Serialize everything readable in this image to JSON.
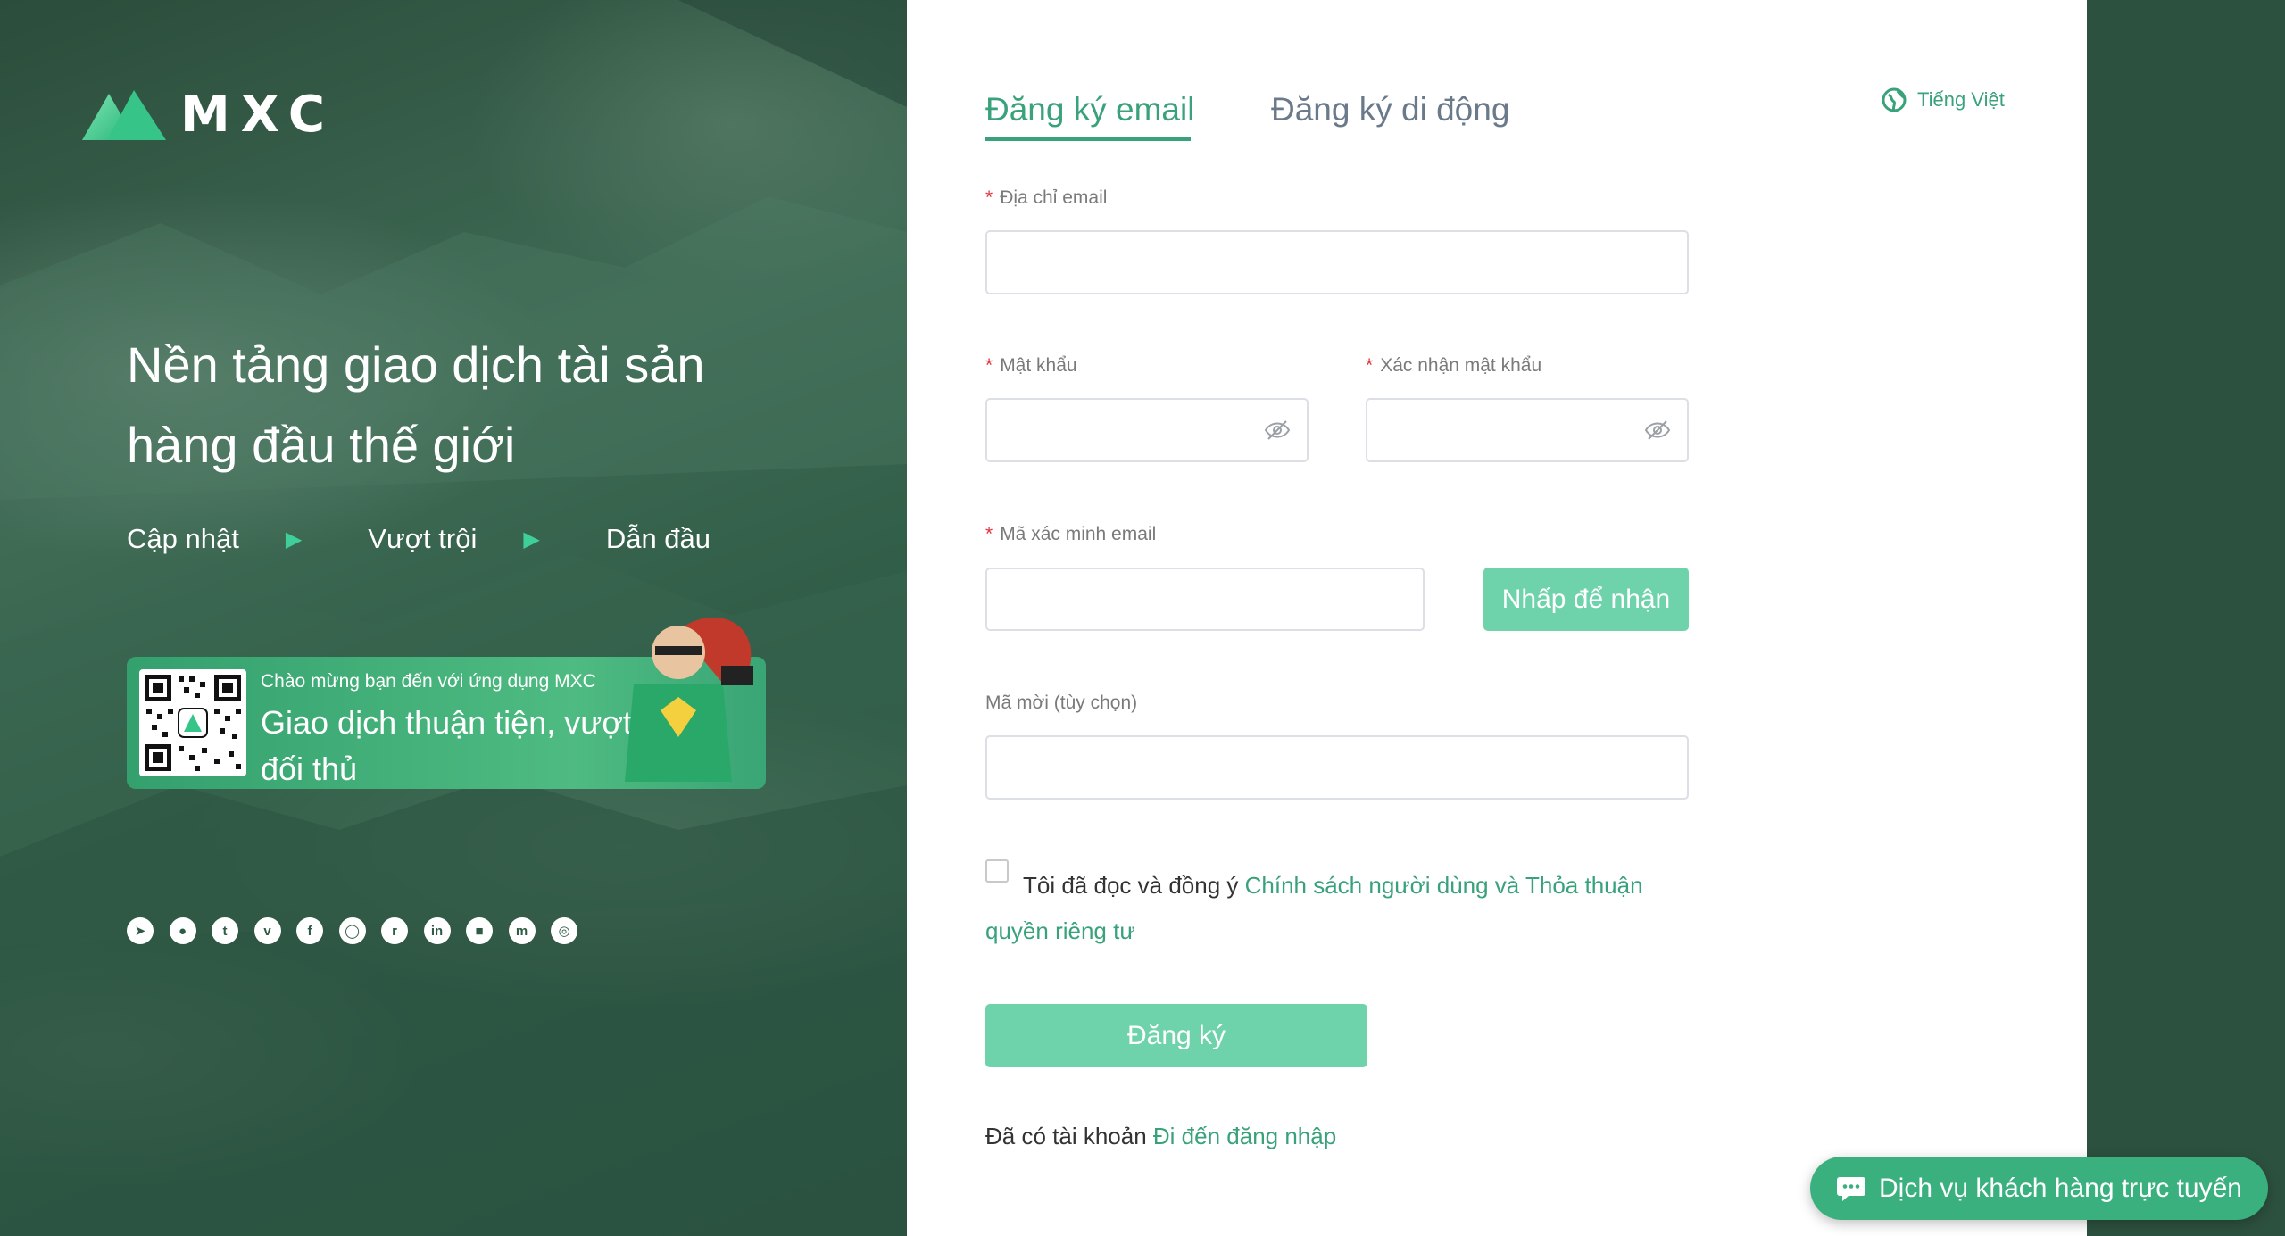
{
  "brand": {
    "name": "MXC"
  },
  "hero": {
    "headline": "Nền tảng giao dịch tài sản hàng đầu thế giới",
    "tagline": [
      "Cập nhật",
      "Vượt trội",
      "Dẫn đầu"
    ],
    "app_banner": {
      "small_text": "Chào mừng bạn đến với ứng dụng MXC",
      "big_text": "Giao dịch thuận tiện, vượt tầm đối thủ"
    },
    "social_icons": [
      "telegram-icon",
      "weibo-icon",
      "twitter-icon",
      "vk-icon",
      "facebook-icon",
      "discord-icon",
      "reddit-icon",
      "linkedin-icon",
      "medium-icon",
      "coinmarketcap-icon",
      "circle-icon"
    ]
  },
  "form": {
    "tabs": [
      {
        "label": "Đăng ký email",
        "active": true
      },
      {
        "label": "Đăng ký di động",
        "active": false
      }
    ],
    "language": "Tiếng Việt",
    "email_label": "Địa chỉ email",
    "password_label": "Mật khẩu",
    "confirm_password_label": "Xác nhận mật khẩu",
    "email_code_label": "Mã xác minh email",
    "get_code_button": "Nhấp để nhận",
    "invite_label": "Mã mời (tùy chọn)",
    "agree_text": "Tôi đã đọc và đồng ý ",
    "agree_link_1": "Chính sách người dùng và Thỏa thuận",
    "agree_link_2": "quyền riêng tư",
    "submit_button": "Đăng ký",
    "have_account": "Đã có tài khoản ",
    "login_link": "Đi đến đăng nhập"
  },
  "support": {
    "label": "Dịch vụ khách hàng trực tuyến"
  },
  "colors": {
    "accent": "#3aa27a",
    "button": "#6ed3ab",
    "required": "#e0333c"
  }
}
